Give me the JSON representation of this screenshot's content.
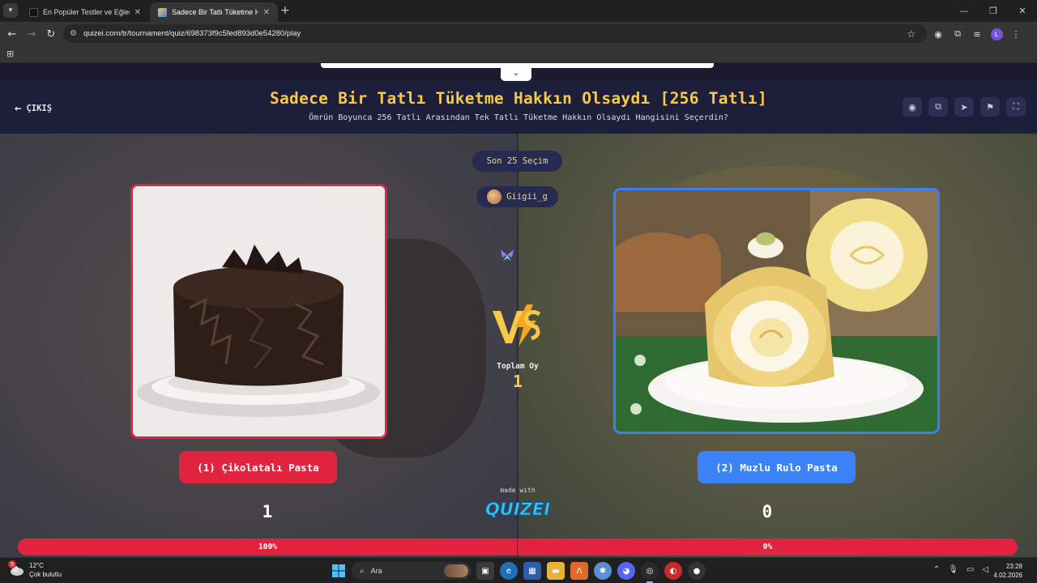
{
  "browser": {
    "tabs": [
      {
        "title": "En Popüler Testler ve Eğlenceli",
        "active": false
      },
      {
        "title": "Sadece Bir Tatlı Tüketme Hakkı",
        "active": true
      }
    ],
    "url": "quizei.com/tr/tournament/quiz/698373f9c5fed893d0e54280/play",
    "profile_initial": "L"
  },
  "page": {
    "exit_label": "ÇIKIŞ",
    "title": "Sadece Bir Tatlı Tüketme Hakkın Olsaydı [256 Tatlı]",
    "subtitle": "Ömrün Boyunca 256 Tatlı Arasından Tek Tatlı Tüketme Hakkın Olsaydı Hangisini Seçerdin?",
    "last_choices_label": "Son 25 Seçim",
    "username": "Giigii_g",
    "total_votes_label": "Toplam Oy",
    "total_votes": "1",
    "made_with": "made with",
    "brand": "QUIZEI",
    "choices": [
      {
        "label": "(1) Çikolatalı Pasta",
        "votes": "1",
        "percent_label": "100%",
        "percent": 100,
        "color": "#e0243f"
      },
      {
        "label": "(2) Muzlu Rulo Pasta",
        "votes": "0",
        "percent_label": "0%",
        "percent": 0,
        "color": "#3a82f6"
      }
    ]
  },
  "taskbar": {
    "weather_badge": "9",
    "temperature": "12°C",
    "condition": "Çok bulutlu",
    "search_placeholder": "Ara",
    "time": "23:28",
    "date": "4.02.2026"
  }
}
